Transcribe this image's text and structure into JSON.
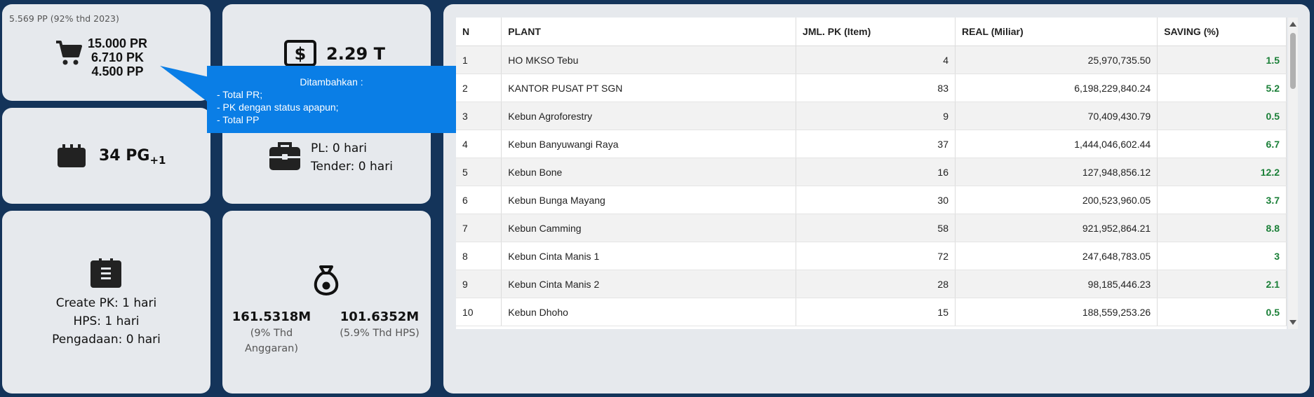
{
  "cards": {
    "pr": {
      "note": "5.569 PP (92% thd 2023)",
      "icon": "cart-icon",
      "pr": "15.000 PR",
      "pk": "6.710 PK",
      "pp": "4.500 PP"
    },
    "total": {
      "icon": "dollar-icon",
      "value": "2.29 T"
    },
    "pg": {
      "icon": "calendar-icon",
      "value": "34 PG",
      "sub": "+1"
    },
    "days": {
      "icon": "briefcase-icon",
      "pl": "PL: 0 hari",
      "tender": "Tender: 0 hari"
    },
    "create": {
      "icon": "clipboard-icon",
      "create_pk": "Create PK: 1 hari",
      "hps": "HPS: 1 hari",
      "pengadaan": "Pengadaan: 0 hari"
    },
    "money": {
      "icon": "money-bag-icon",
      "left_value": "161.5318M",
      "left_caption": "(9% Thd Anggaran)",
      "right_value": "101.6352M",
      "right_caption": "(5.9% Thd HPS)"
    }
  },
  "tooltip": {
    "title": "Ditambahkan :",
    "lines": [
      "- Total PR;",
      "- PK dengan status apapun;",
      "- Total PP"
    ]
  },
  "table": {
    "headers": [
      "N",
      "PLANT",
      "JML. PK (Item)",
      "REAL (Miliar)",
      "SAVING (%)"
    ],
    "rows": [
      [
        "1",
        "HO MKSO Tebu",
        "4",
        "25,970,735.50",
        "1.5"
      ],
      [
        "2",
        "KANTOR PUSAT PT SGN",
        "83",
        "6,198,229,840.24",
        "5.2"
      ],
      [
        "3",
        "Kebun Agroforestry",
        "9",
        "70,409,430.79",
        "0.5"
      ],
      [
        "4",
        "Kebun Banyuwangi Raya",
        "37",
        "1,444,046,602.44",
        "6.7"
      ],
      [
        "5",
        "Kebun Bone",
        "16",
        "127,948,856.12",
        "12.2"
      ],
      [
        "6",
        "Kebun Bunga Mayang",
        "30",
        "200,523,960.05",
        "3.7"
      ],
      [
        "7",
        "Kebun Camming",
        "58",
        "921,952,864.21",
        "8.8"
      ],
      [
        "8",
        "Kebun Cinta Manis 1",
        "72",
        "247,648,783.05",
        "3"
      ],
      [
        "9",
        "Kebun Cinta Manis 2",
        "28",
        "98,185,446.23",
        "2.1"
      ],
      [
        "10",
        "Kebun Dhoho",
        "15",
        "188,559,253.26",
        "0.5"
      ]
    ]
  },
  "colors": {
    "background": "#14345a",
    "card": "#e6e9ed",
    "tooltip": "#0a7ee6",
    "saving": "#1a7f37"
  }
}
